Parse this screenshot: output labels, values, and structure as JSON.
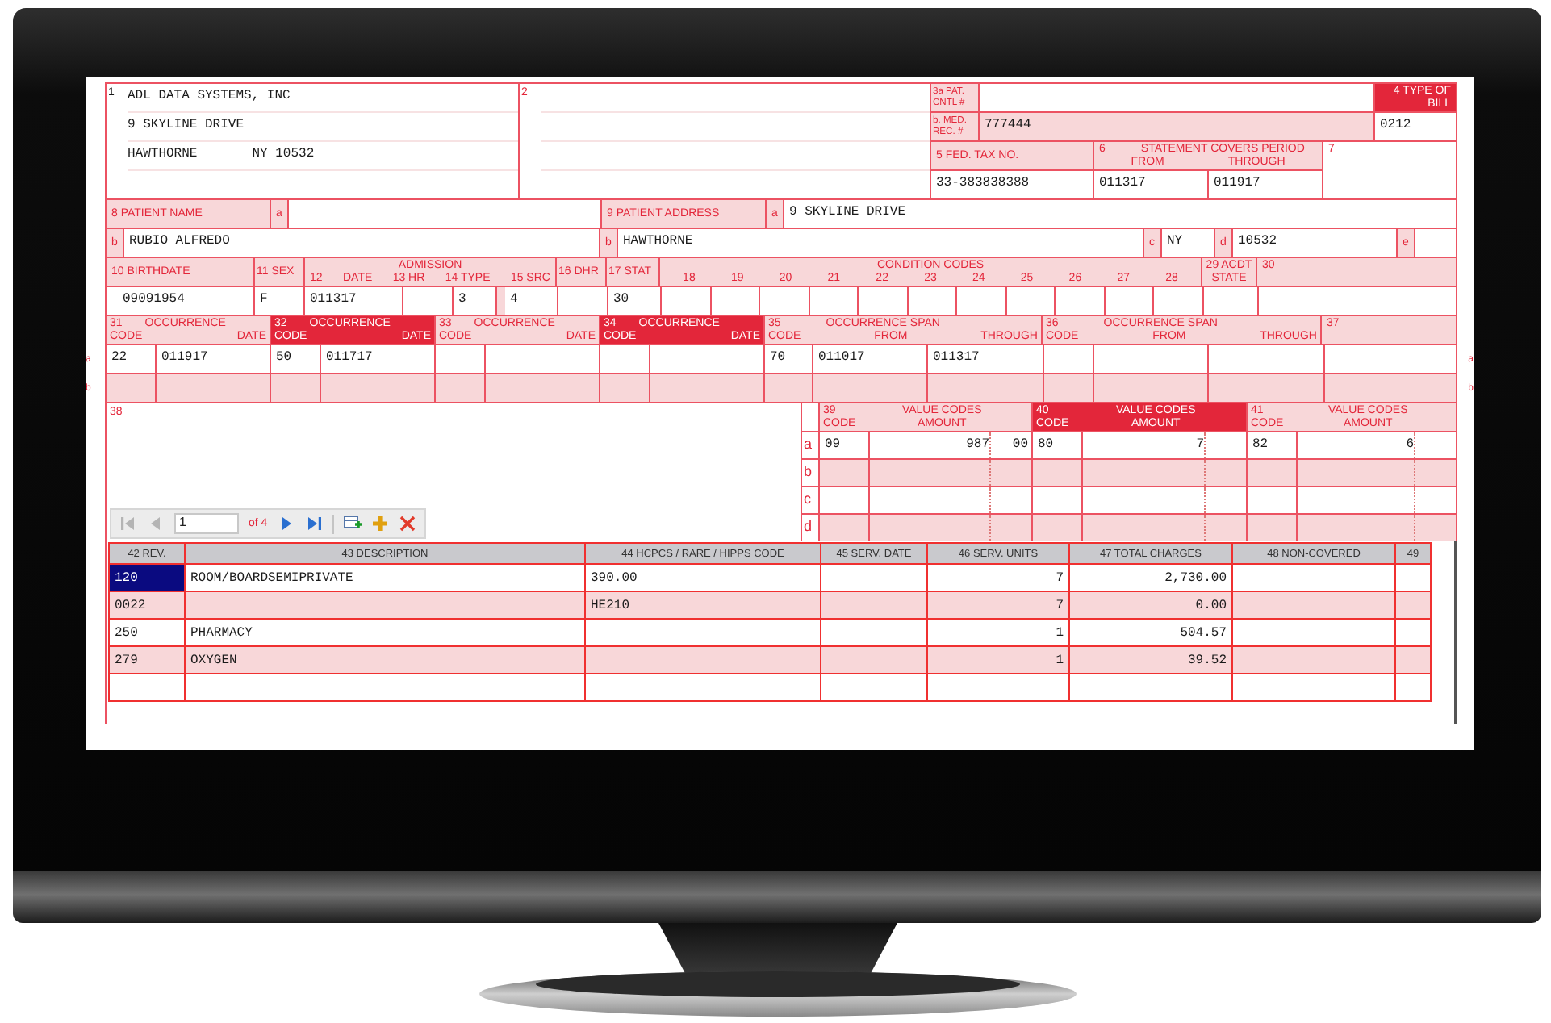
{
  "provider": {
    "number": "1",
    "name": "ADL DATA SYSTEMS, INC",
    "street": "9 SKYLINE DRIVE",
    "city": "HAWTHORNE",
    "state_zip": "NY 10532"
  },
  "box_2": {
    "number": "2"
  },
  "patient_control": {
    "label": "3a PAT. CNTL #"
  },
  "medical_record": {
    "label": "b. MED. REC. #",
    "value": "777444"
  },
  "type_of_bill": {
    "label": "4 TYPE OF BILL",
    "value": "0212"
  },
  "federal_tax": {
    "label": "5 FED. TAX NO.",
    "value": "33-383838388"
  },
  "statement_period": {
    "number": "6",
    "title": "STATEMENT COVERS PERIOD",
    "from_label": "FROM",
    "through_label": "THROUGH",
    "from": "011317",
    "through": "011917"
  },
  "box_7": {
    "number": "7"
  },
  "patient_name": {
    "label": "8 PATIENT NAME",
    "letters": [
      "a",
      "b"
    ],
    "value": "RUBIO ALFREDO"
  },
  "patient_address": {
    "label": "9 PATIENT ADDRESS",
    "parts": [
      {
        "letter": "a",
        "value": "9 SKYLINE DRIVE"
      },
      {
        "letter": "b",
        "value": "HAWTHORNE"
      },
      {
        "letter": "c",
        "value": "NY"
      },
      {
        "letter": "d",
        "value": "10532"
      },
      {
        "letter": "e"
      }
    ]
  },
  "birthdate": {
    "label": "10 BIRTHDATE",
    "value": "09091954"
  },
  "sex": {
    "label": "11 SEX",
    "value": "F"
  },
  "admission": {
    "title": "ADMISSION",
    "labels": [
      "12",
      "DATE",
      "13 HR",
      "14 TYPE",
      "15 SRC"
    ],
    "date": "011317",
    "type": "3",
    "source": "4"
  },
  "discharge_hour": {
    "label": "16 DHR"
  },
  "status": {
    "label": "17 STAT",
    "value": "30"
  },
  "condition_codes": {
    "title": "CONDITION CODES",
    "numbers": [
      "18",
      "19",
      "20",
      "21",
      "22",
      "23",
      "24",
      "25",
      "26",
      "27",
      "28"
    ]
  },
  "accident_state": {
    "label": "29 ACDT STATE"
  },
  "box_30": {
    "number": "30"
  },
  "occurrence_letters_left": [
    "a",
    "b"
  ],
  "occurrence_letters_right": [
    "a",
    "b"
  ],
  "occurrences": [
    {
      "number": "31",
      "title": "OCCURRENCE",
      "code_label": "CODE",
      "date_label": "DATE",
      "highlighted": false,
      "rows": [
        {
          "code": "22",
          "date": "011917"
        }
      ]
    },
    {
      "number": "32",
      "title": "OCCURRENCE",
      "code_label": "CODE",
      "date_label": "DATE",
      "highlighted": true,
      "rows": [
        {
          "code": "50",
          "date": "011717"
        }
      ]
    },
    {
      "number": "33",
      "title": "OCCURRENCE",
      "code_label": "CODE",
      "date_label": "DATE",
      "highlighted": false
    },
    {
      "number": "34",
      "title": "OCCURRENCE",
      "code_label": "CODE",
      "date_label": "DATE",
      "highlighted": true
    }
  ],
  "occurrence_spans": [
    {
      "number": "35",
      "title": "OCCURRENCE SPAN",
      "code_label": "CODE",
      "from_label": "FROM",
      "through_label": "THROUGH",
      "rows": [
        {
          "code": "70",
          "from": "011017",
          "through": "011317"
        }
      ]
    },
    {
      "number": "36",
      "title": "OCCURRENCE SPAN",
      "code_label": "CODE",
      "from_label": "FROM",
      "through_label": "THROUGH"
    }
  ],
  "box_37": {
    "number": "37"
  },
  "remarks": {
    "number": "38"
  },
  "pager": {
    "page": "1",
    "total": "of 4",
    "at_first": true
  },
  "value_codes": {
    "letters": [
      "a",
      "b",
      "c",
      "d"
    ],
    "groups": [
      {
        "number": "39",
        "code_label": "CODE",
        "title": "VALUE CODES",
        "amount_label": "AMOUNT",
        "highlighted": false,
        "rows": [
          {
            "code": "09",
            "amount": "987",
            "cents": "00"
          }
        ]
      },
      {
        "number": "40",
        "code_label": "CODE",
        "title": "VALUE CODES",
        "amount_label": "AMOUNT",
        "highlighted": true,
        "rows": [
          {
            "code": "80",
            "amount": "7"
          }
        ]
      },
      {
        "number": "41",
        "code_label": "CODE",
        "title": "VALUE CODES",
        "amount_label": "AMOUNT",
        "highlighted": false,
        "rows": [
          {
            "code": "82",
            "amount": "6"
          }
        ]
      }
    ]
  },
  "line_items": {
    "columns": [
      "42 REV.",
      "43 DESCRIPTION",
      "44 HCPCS / RARE / HIPPS CODE",
      "45 SERV. DATE",
      "46 SERV. UNITS",
      "47 TOTAL CHARGES",
      "48 NON-COVERED",
      "49"
    ],
    "rows": [
      {
        "selected": true,
        "cells": [
          "120",
          "ROOM/BOARDSEMIPRIVATE",
          "390.00",
          null,
          "7",
          "2,730.00",
          null,
          null
        ]
      },
      {
        "selected": false,
        "cells": [
          "0022",
          null,
          "HE210",
          null,
          "7",
          "0.00",
          null,
          null
        ]
      },
      {
        "selected": false,
        "cells": [
          "250",
          "PHARMACY",
          null,
          null,
          "1",
          "504.57",
          null,
          null
        ]
      },
      {
        "selected": false,
        "cells": [
          "279",
          "OXYGEN",
          null,
          null,
          "1",
          "39.52",
          null,
          null
        ]
      }
    ]
  }
}
